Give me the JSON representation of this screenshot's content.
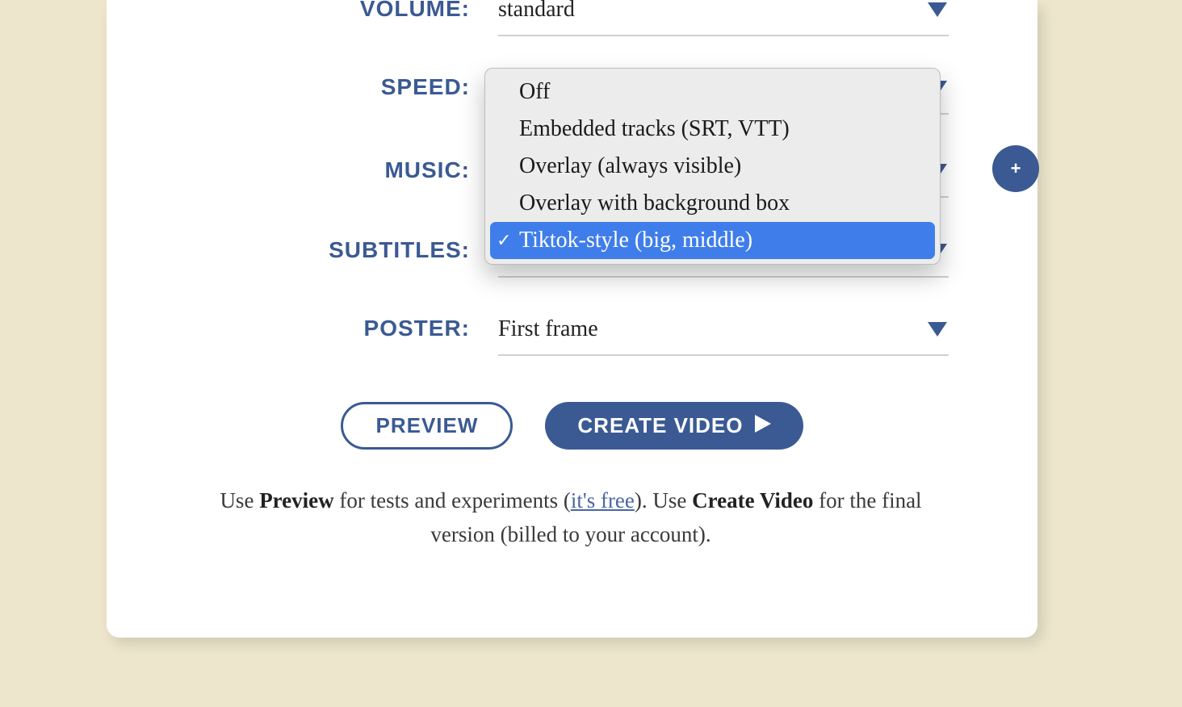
{
  "form": {
    "volume": {
      "label": "VOLUME:",
      "value": "standard"
    },
    "speed": {
      "label": "SPEED:"
    },
    "music": {
      "label": "MUSIC:"
    },
    "subtitles": {
      "label": "SUBTITLES:"
    },
    "poster": {
      "label": "POSTER:",
      "value": "First frame"
    }
  },
  "dropdown": {
    "options": [
      "Off",
      "Embedded tracks (SRT, VTT)",
      "Overlay (always visible)",
      "Overlay with background box",
      "Tiktok-style (big, middle)"
    ],
    "selected_index": 4
  },
  "buttons": {
    "preview": "PREVIEW",
    "create": "CREATE VIDEO"
  },
  "hint": {
    "t1": "Use ",
    "t2": "Preview",
    "t3": " for tests and experiments (",
    "link": "it's free",
    "t4": "). Use ",
    "t5": "Create Video",
    "t6": " for the final version (billed to your account)."
  },
  "icons": {
    "plus": "+",
    "check": "✓"
  }
}
